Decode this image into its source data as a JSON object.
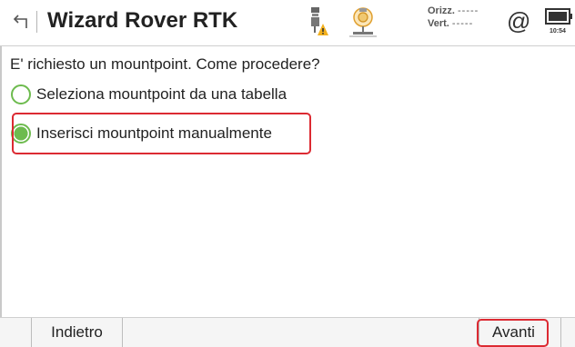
{
  "header": {
    "title": "Wizard Rover RTK",
    "precision": {
      "horizontal_label": "Orizz.",
      "horizontal_value": "-----",
      "vertical_label": "Vert.",
      "vertical_value": "-----"
    },
    "at_symbol": "@",
    "time": "10:54",
    "icons": [
      "back-arrow-icon",
      "gps-antenna-warning-icon",
      "total-station-icon",
      "at-icon",
      "battery-icon"
    ]
  },
  "prompt": "E' richiesto un mountpoint. Come procedere?",
  "options": [
    {
      "label": "Seleziona mountpoint da una tabella",
      "selected": false
    },
    {
      "label": "Inserisci mountpoint manualmente",
      "selected": true
    }
  ],
  "footer": {
    "back_label": "Indietro",
    "next_label": "Avanti"
  },
  "colors": {
    "accent_green": "#6dbb4e",
    "highlight_red": "#dc2a32",
    "warning_yellow": "#f2b01e"
  }
}
